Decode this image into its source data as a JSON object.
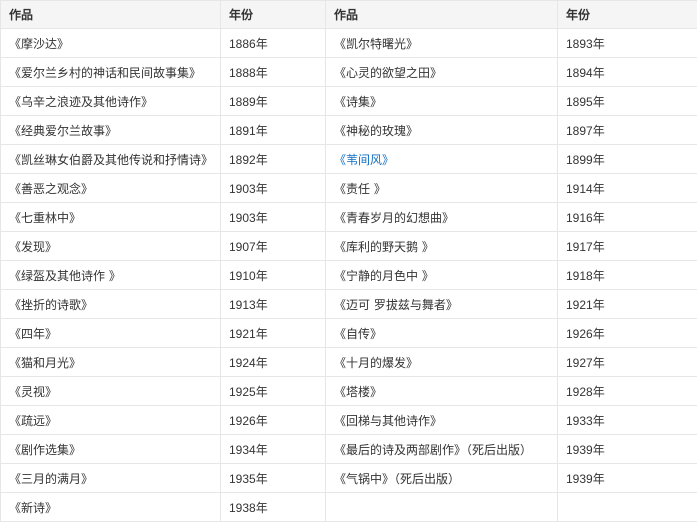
{
  "table": {
    "headers": [
      "作品",
      "年份",
      "作品",
      "年份"
    ],
    "rows": [
      {
        "left_work": "《摩沙达》",
        "left_year": "1886年",
        "right_work": "《凯尔特曙光》",
        "right_year": "1893年"
      },
      {
        "left_work": "《爱尔兰乡村的神话和民间故事集》",
        "left_year": "1888年",
        "right_work": "《心灵的欲望之田》",
        "right_year": "1894年"
      },
      {
        "left_work": "《乌辛之浪迹及其他诗作》",
        "left_year": "1889年",
        "right_work": "《诗集》",
        "right_year": "1895年"
      },
      {
        "left_work": "《经典爱尔兰故事》",
        "left_year": "1891年",
        "right_work": "《神秘的玫瑰》",
        "right_year": "1897年"
      },
      {
        "left_work": "《凯丝琳女伯爵及其他传说和抒情诗》",
        "left_year": "1892年",
        "right_work": "《苇间风》",
        "right_year": "1899年",
        "right_is_link": true
      },
      {
        "left_work": "《善恶之观念》",
        "left_year": "1903年",
        "right_work": "《责任 》",
        "right_year": "1914年"
      },
      {
        "left_work": "《七重林中》",
        "left_year": "1903年",
        "right_work": "《青春岁月的幻想曲》",
        "right_year": "1916年"
      },
      {
        "left_work": "《发现》",
        "left_year": "1907年",
        "right_work": "《库利的野天鹅 》",
        "right_year": "1917年"
      },
      {
        "left_work": "《绿盔及其他诗作 》",
        "left_year": "1910年",
        "right_work": "《宁静的月色中 》",
        "right_year": "1918年"
      },
      {
        "left_work": "《挫折的诗歌》",
        "left_year": "1913年",
        "right_work": "《迈可 罗拔兹与舞者》",
        "right_year": "1921年"
      },
      {
        "left_work": "《四年》",
        "left_year": "1921年",
        "right_work": "《自传》",
        "right_year": "1926年"
      },
      {
        "left_work": "《猫和月光》",
        "left_year": "1924年",
        "right_work": "《十月的爆发》",
        "right_year": "1927年"
      },
      {
        "left_work": "《灵视》",
        "left_year": "1925年",
        "right_work": "《塔楼》",
        "right_year": "1928年"
      },
      {
        "left_work": "《疏远》",
        "left_year": "1926年",
        "right_work": "《回梯与其他诗作》",
        "right_year": "1933年"
      },
      {
        "left_work": "《剧作选集》",
        "left_year": "1934年",
        "right_work": "《最后的诗及两部剧作》（死后出版）",
        "right_year": "1939年"
      },
      {
        "left_work": "《三月的满月》",
        "left_year": "1935年",
        "right_work": "《气锅中》（死后出版）",
        "right_year": "1939年"
      },
      {
        "left_work": "《新诗》",
        "left_year": "1938年",
        "right_work": "",
        "right_year": ""
      }
    ],
    "colors": {
      "header_bg": "#f5f5f5",
      "border": "#e6e6e6",
      "text": "#333333",
      "link": "#136ec2"
    }
  }
}
